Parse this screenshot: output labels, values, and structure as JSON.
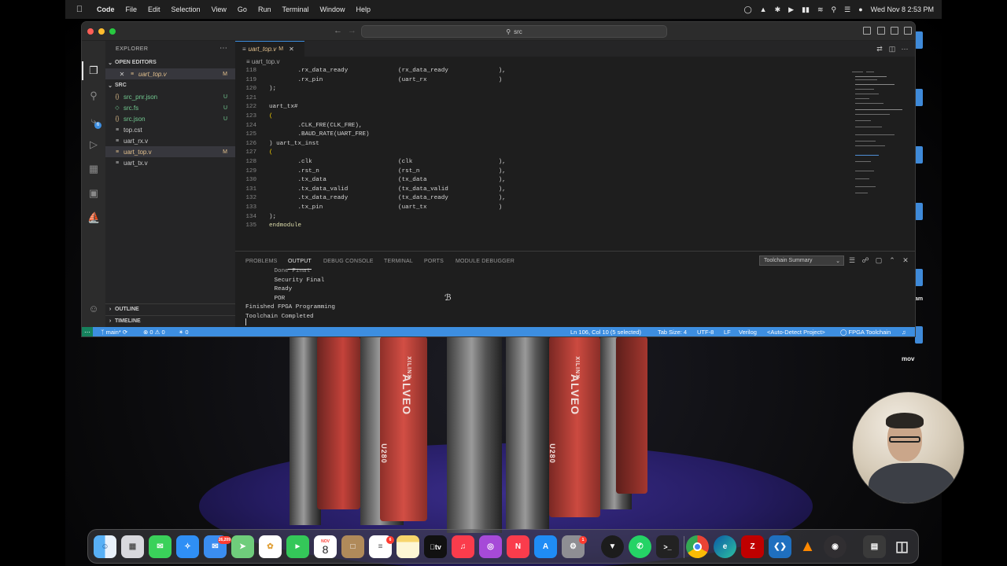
{
  "menubar": {
    "app_name": "Code",
    "menus": [
      "File",
      "Edit",
      "Selection",
      "View",
      "Go",
      "Run",
      "Terminal",
      "Window",
      "Help"
    ],
    "datetime": "Wed Nov 8  2:53 PM"
  },
  "window": {
    "command_center": "src"
  },
  "sidebar": {
    "title": "EXPLORER",
    "open_editors_label": "OPEN EDITORS",
    "open_editors": [
      {
        "name": "uart_top.v",
        "status": "M"
      }
    ],
    "folder_label": "SRC",
    "files": [
      {
        "name": "src_pnr.json",
        "status": "U",
        "kind": "json"
      },
      {
        "name": "src.fs",
        "status": "U",
        "kind": "fs"
      },
      {
        "name": "src.json",
        "status": "U",
        "kind": "json"
      },
      {
        "name": "top.cst",
        "status": "",
        "kind": "text"
      },
      {
        "name": "uart_rx.v",
        "status": "",
        "kind": "text"
      },
      {
        "name": "uart_top.v",
        "status": "M",
        "kind": "text"
      },
      {
        "name": "uart_tx.v",
        "status": "",
        "kind": "text"
      }
    ],
    "outline_label": "OUTLINE",
    "timeline_label": "TIMELINE",
    "scm_badge": "6"
  },
  "editor": {
    "tab": {
      "name": "uart_top.v",
      "status": "M"
    },
    "breadcrumb": "uart_top.v",
    "lines": [
      {
        "n": "118",
        "t": "        .rx_data_ready              (rx_data_ready              ),"
      },
      {
        "n": "119",
        "t": "        .rx_pin                     (uart_rx                    )"
      },
      {
        "n": "120",
        "t": ");"
      },
      {
        "n": "121",
        "t": ""
      },
      {
        "n": "122",
        "t": "uart_tx#"
      },
      {
        "n": "123",
        "t": "("
      },
      {
        "n": "124",
        "t": "        .CLK_FRE(CLK_FRE),"
      },
      {
        "n": "125",
        "t": "        .BAUD_RATE(UART_FRE)"
      },
      {
        "n": "126",
        "t": ") uart_tx_inst"
      },
      {
        "n": "127",
        "t": "("
      },
      {
        "n": "128",
        "t": "        .clk                        (clk                        ),"
      },
      {
        "n": "129",
        "t": "        .rst_n                      (rst_n                      ),"
      },
      {
        "n": "130",
        "t": "        .tx_data                    (tx_data                    ),"
      },
      {
        "n": "131",
        "t": "        .tx_data_valid              (tx_data_valid              ),"
      },
      {
        "n": "132",
        "t": "        .tx_data_ready              (tx_data_ready              ),"
      },
      {
        "n": "133",
        "t": "        .tx_pin                     (uart_tx                    )"
      },
      {
        "n": "134",
        "t": ");"
      },
      {
        "n": "135",
        "t": "endmodule"
      }
    ]
  },
  "panel": {
    "tabs": [
      "PROBLEMS",
      "OUTPUT",
      "DEBUG CONSOLE",
      "TERMINAL",
      "PORTS",
      "MODULE DEBUGGER"
    ],
    "active_tab": "OUTPUT",
    "channel": "Toolchain Summary",
    "output_lines": [
      "        Done Final",
      "        Security Final",
      "        Ready",
      "        POR",
      "Finished FPGA Programming",
      "Toolchain Completed"
    ]
  },
  "statusbar": {
    "branch": "main*",
    "errors": "0",
    "warnings": "0",
    "ports": "0",
    "position": "Ln 106, Col 10 (5 selected)",
    "tab_size": "Tab Size: 4",
    "encoding": "UTF-8",
    "eol": "LF",
    "language": "Verilog",
    "project": "<Auto-Detect Project>",
    "toolchain": "FPGA Toolchain"
  },
  "desktop": {
    "label_am": "am",
    "label_mov": "mov",
    "card_text": "ALVEO",
    "card_model": "U280",
    "card_brand": "XILINX"
  },
  "dock": {
    "mail_badge": "26,209",
    "calendar_month": "NOV",
    "calendar_day": "8",
    "reminders_badge": "6",
    "settings_badge": "1",
    "apps": [
      "finder-icon",
      "launchpad-icon",
      "messages-icon",
      "safari-icon",
      "mail-icon",
      "maps-icon",
      "photos-icon",
      "facetime-icon",
      "calendar-icon",
      "notes-app-icon",
      "reminders-icon",
      "notes-icon",
      "tv-icon",
      "music-icon",
      "podcasts-icon",
      "news-icon",
      "app-store-icon",
      "system-settings-icon",
      "cursor-app-icon",
      "whatsapp-icon",
      "terminal-icon",
      "chrome-icon",
      "edge-icon",
      "filezilla-icon",
      "vscode-icon",
      "vlc-icon",
      "obs-icon",
      "screen-icon",
      "trash-icon"
    ]
  }
}
